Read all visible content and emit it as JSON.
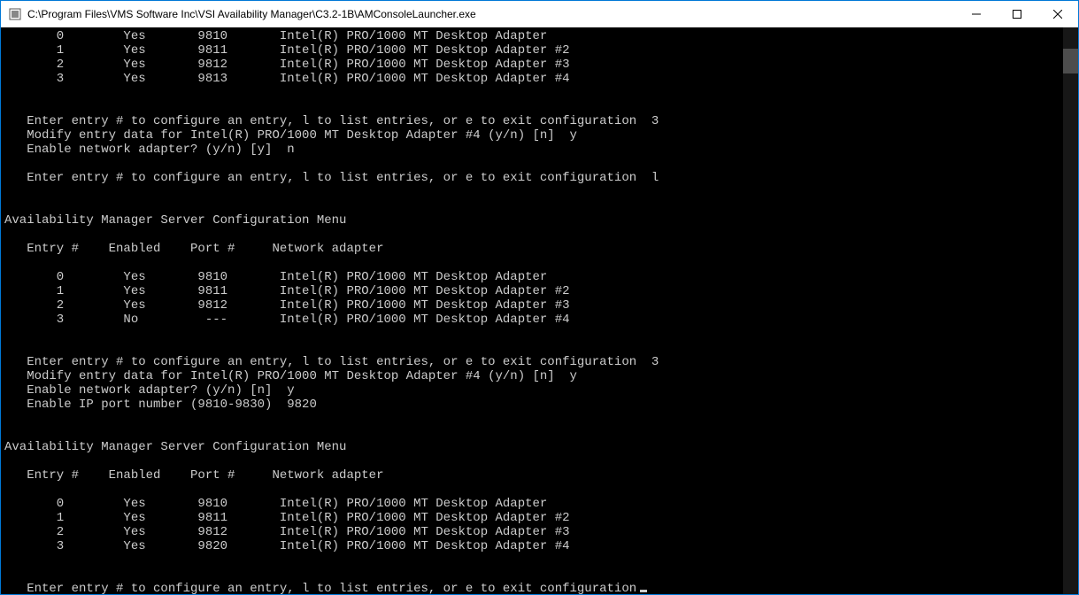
{
  "window": {
    "title": "C:\\Program Files\\VMS Software Inc\\VSI Availability Manager\\C3.2-1B\\AMConsoleLauncher.exe"
  },
  "menu_title": "Availability Manager Server Configuration Menu",
  "table_headers": {
    "entry": "Entry #",
    "enabled": "Enabled",
    "port": "Port #",
    "adapter": "Network adapter"
  },
  "prompts": {
    "configure": "Enter entry # to configure an entry, l to list entries, or e to exit configuration",
    "modify_prefix": "Modify entry data for ",
    "modify_suffix": " (y/n) [n]",
    "enable_adapter_y": "Enable network adapter? (y/n) [y]",
    "enable_adapter_n": "Enable network adapter? (y/n) [n]",
    "enable_port": "Enable IP port number (9810-9830)"
  },
  "inputs": {
    "first_entry": "3",
    "first_modify": "y",
    "first_enable": "n",
    "list": "l",
    "second_entry": "3",
    "second_modify": "y",
    "second_enable": "y",
    "port": "9820"
  },
  "tables": {
    "initial": [
      {
        "entry": "0",
        "enabled": "Yes",
        "port": "9810",
        "adapter": "Intel(R) PRO/1000 MT Desktop Adapter"
      },
      {
        "entry": "1",
        "enabled": "Yes",
        "port": "9811",
        "adapter": "Intel(R) PRO/1000 MT Desktop Adapter #2"
      },
      {
        "entry": "2",
        "enabled": "Yes",
        "port": "9812",
        "adapter": "Intel(R) PRO/1000 MT Desktop Adapter #3"
      },
      {
        "entry": "3",
        "enabled": "Yes",
        "port": "9813",
        "adapter": "Intel(R) PRO/1000 MT Desktop Adapter #4"
      }
    ],
    "after_disable": [
      {
        "entry": "0",
        "enabled": "Yes",
        "port": "9810",
        "adapter": "Intel(R) PRO/1000 MT Desktop Adapter"
      },
      {
        "entry": "1",
        "enabled": "Yes",
        "port": "9811",
        "adapter": "Intel(R) PRO/1000 MT Desktop Adapter #2"
      },
      {
        "entry": "2",
        "enabled": "Yes",
        "port": "9812",
        "adapter": "Intel(R) PRO/1000 MT Desktop Adapter #3"
      },
      {
        "entry": "3",
        "enabled": "No",
        "port": "---",
        "adapter": "Intel(R) PRO/1000 MT Desktop Adapter #4"
      }
    ],
    "after_enable": [
      {
        "entry": "0",
        "enabled": "Yes",
        "port": "9810",
        "adapter": "Intel(R) PRO/1000 MT Desktop Adapter"
      },
      {
        "entry": "1",
        "enabled": "Yes",
        "port": "9811",
        "adapter": "Intel(R) PRO/1000 MT Desktop Adapter #2"
      },
      {
        "entry": "2",
        "enabled": "Yes",
        "port": "9812",
        "adapter": "Intel(R) PRO/1000 MT Desktop Adapter #3"
      },
      {
        "entry": "3",
        "enabled": "Yes",
        "port": "9820",
        "adapter": "Intel(R) PRO/1000 MT Desktop Adapter #4"
      }
    ]
  },
  "modify_target": "Intel(R) PRO/1000 MT Desktop Adapter #4"
}
